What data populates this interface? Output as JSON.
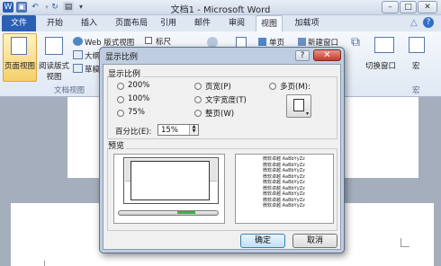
{
  "window": {
    "title": "文档1 - Microsoft Word",
    "minimize": "–",
    "maximize": "□",
    "close": "✕"
  },
  "tabs": {
    "file": "文件",
    "items": [
      "开始",
      "插入",
      "页面布局",
      "引用",
      "邮件",
      "审阅",
      "视图",
      "加载项"
    ],
    "active": "视图"
  },
  "ribbon": {
    "page_view": "页面视图",
    "reading_view_1": "阅读版式",
    "reading_view_2": "视图",
    "web_view": "Web 版式视图",
    "outline_partial": "大纲",
    "draft_partial": "草稿",
    "ruler": "标尺",
    "single_page": "单页",
    "new_window": "新建窗口",
    "switch_windows": "切换窗口",
    "macros": "宏",
    "group_doc_views": "文档视图",
    "group_macros": "宏"
  },
  "dialog": {
    "title": "显示比例",
    "help": "?",
    "close": "✕",
    "section_zoom": "显示比例",
    "options": {
      "p200": "200%",
      "p100": "100%",
      "p75": "75%",
      "page_width": "页宽(P)",
      "text_width": "文字宽度(T)",
      "whole_page": "整页(W)",
      "many_pages": "多页(M):"
    },
    "percent_label": "百分比(E):",
    "percent_value": "15%",
    "preview_label": "预览",
    "sample_lines": [
      "微软卓越 AaBbYyZz",
      "微软卓越 AaBbYyZz",
      "微软卓越 AaBbYyZz",
      "微软卓越 AaBbYyZz",
      "微软卓越 AaBbYyZz",
      "微软卓越 AaBbYyZz",
      "微软卓越 AaBbYyZz",
      "微软卓越 AaBbYyZz",
      "微软卓越 AaBbYyZz"
    ],
    "ok": "确定",
    "cancel": "取消"
  }
}
